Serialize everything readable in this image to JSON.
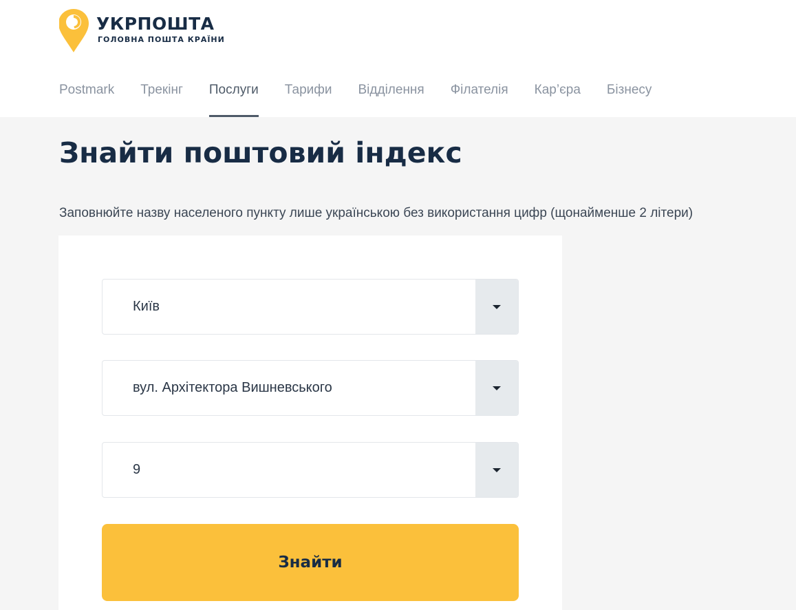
{
  "brand": {
    "title": "УКРПОШТА",
    "subtitle": "ГОЛОВНА ПОШТА КРАЇНИ",
    "logo_icon": "map-pin-icon",
    "accent_color": "#fbc03b"
  },
  "nav": {
    "items": [
      {
        "label": "Postmark",
        "active": false
      },
      {
        "label": "Трекінг",
        "active": false
      },
      {
        "label": "Послуги",
        "active": true
      },
      {
        "label": "Тарифи",
        "active": false
      },
      {
        "label": "Відділення",
        "active": false
      },
      {
        "label": "Філателія",
        "active": false
      },
      {
        "label": "Кар’єра",
        "active": false
      },
      {
        "label": "Бізнесу",
        "active": false
      }
    ]
  },
  "main": {
    "title": "Знайти поштовий індекс",
    "hint": "Заповнюйте назву населеного пункту лише українською без використання цифр (щонайменше 2 літери)",
    "fields": {
      "city": "Київ",
      "street": "вул. Архітектора Вишневського",
      "house": "9"
    },
    "submit_label": "Знайти"
  }
}
